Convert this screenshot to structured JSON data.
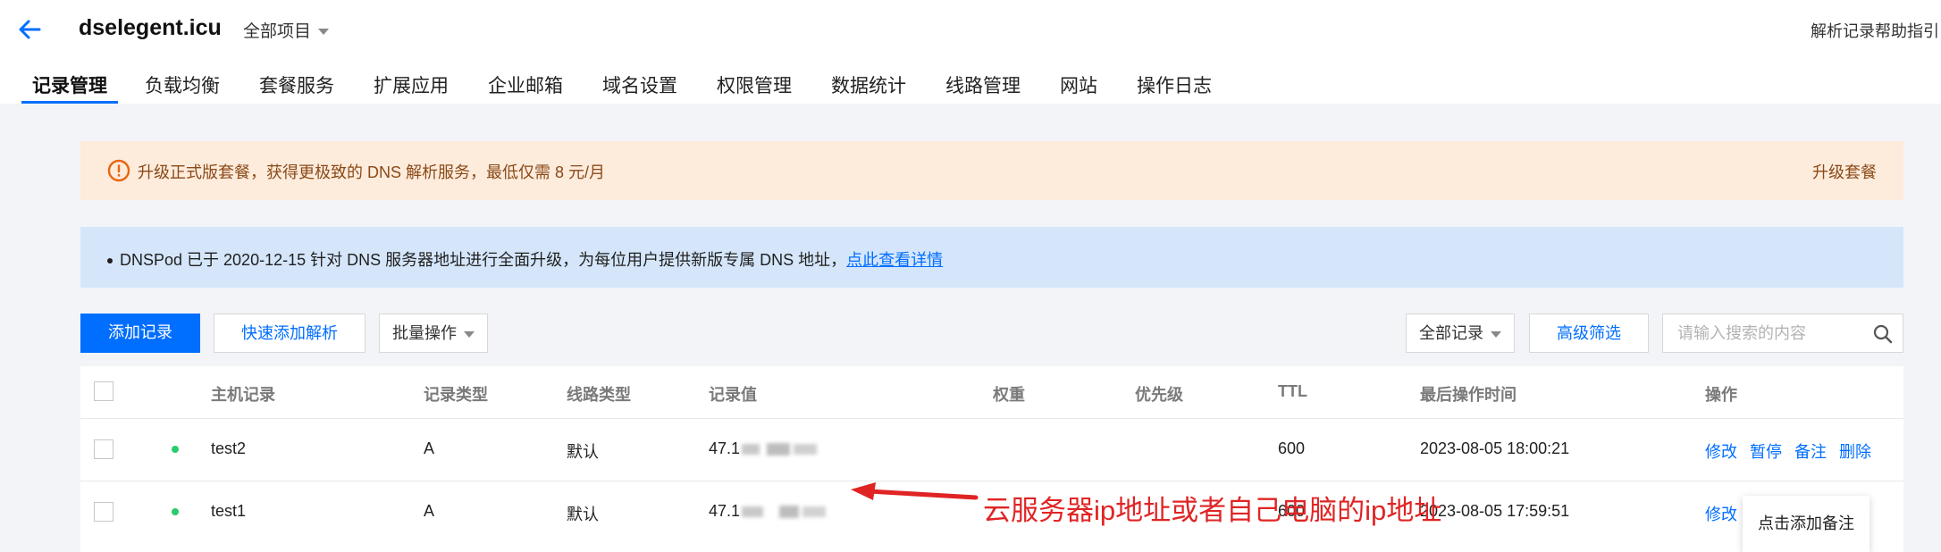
{
  "header": {
    "domain": "dselegent.icu",
    "project_select": "全部项目",
    "help_link": "解析记录帮助指引"
  },
  "tabs": [
    {
      "label": "记录管理",
      "active": true
    },
    {
      "label": "负载均衡"
    },
    {
      "label": "套餐服务"
    },
    {
      "label": "扩展应用"
    },
    {
      "label": "企业邮箱"
    },
    {
      "label": "域名设置"
    },
    {
      "label": "权限管理"
    },
    {
      "label": "数据统计"
    },
    {
      "label": "线路管理"
    },
    {
      "label": "网站"
    },
    {
      "label": "操作日志"
    }
  ],
  "upgrade_notice": {
    "text": "升级正式版套餐，获得更极致的 DNS 解析服务，最低仅需 8 元/月",
    "link": "升级套餐"
  },
  "dns_notice": {
    "text": "DNSPod 已于 2020-12-15 针对 DNS 服务器地址进行全面升级，为每位用户提供新版专属 DNS 地址，",
    "link": "点此查看详情"
  },
  "toolbar": {
    "add_record": "添加记录",
    "quick_add": "快速添加解析",
    "batch": "批量操作",
    "all_records": "全部记录",
    "advanced_filter": "高级筛选",
    "search_placeholder": "请输入搜索的内容"
  },
  "table": {
    "columns": [
      "主机记录",
      "记录类型",
      "线路类型",
      "记录值",
      "权重",
      "优先级",
      "TTL",
      "最后操作时间",
      "操作"
    ],
    "rows": [
      {
        "host": "test2",
        "type": "A",
        "line": "默认",
        "value": "47.1",
        "weight": "",
        "priority": "",
        "ttl": "600",
        "time": "2023-08-05 18:00:21",
        "actions": [
          "修改",
          "暂停",
          "备注",
          "删除"
        ]
      },
      {
        "host": "test1",
        "type": "A",
        "line": "默认",
        "value": "47.1",
        "weight": "",
        "priority": "",
        "ttl": "600",
        "time": "2023-08-05 17:59:51",
        "actions": [
          "修改"
        ]
      }
    ]
  },
  "annotation": {
    "text": "云服务器ip地址或者自己电脑的ip地址",
    "color": "#e02424"
  },
  "tooltip": "点击添加备注",
  "colors": {
    "accent": "#006eff",
    "warning_bg": "#fdebdc",
    "info_bg": "#d5e6fb",
    "status_dot": "#29cc6a"
  }
}
